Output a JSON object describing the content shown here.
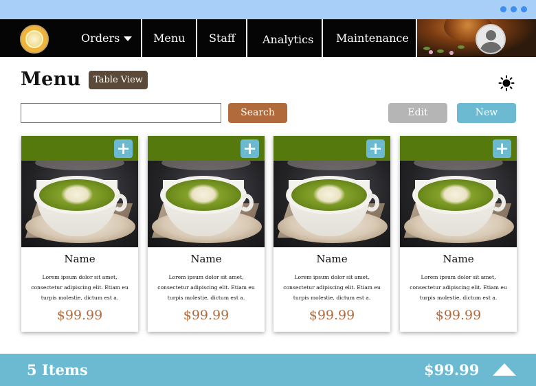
{
  "window": {
    "controls": [
      "dot",
      "dot",
      "dot"
    ]
  },
  "nav": {
    "logo": "lemon-logo-icon",
    "items": [
      {
        "label": "Orders",
        "has_dropdown": true
      },
      {
        "label": "Menu"
      },
      {
        "label": "Staff"
      },
      {
        "label": "Analytics"
      },
      {
        "label": "Maintenance"
      }
    ],
    "avatar": "user-avatar-icon"
  },
  "page": {
    "title": "Menu",
    "view_toggle_label": "Table View",
    "theme_icon": "sun-icon"
  },
  "toolbar": {
    "search_value": "",
    "search_label": "Search",
    "edit_label": "Edit",
    "new_label": "New"
  },
  "cards": [
    {
      "name": "Name",
      "description": "Lorem ipsum dolor sit amet, consectetur adipiscing elit. Etiam eu turpis molestie, dictum est a.",
      "price": "$99.99",
      "add_icon": "plus-icon"
    },
    {
      "name": "Name",
      "description": "Lorem ipsum dolor sit amet, consectetur adipiscing elit. Etiam eu turpis molestie, dictum est a.",
      "price": "$99.99",
      "add_icon": "plus-icon"
    },
    {
      "name": "Name",
      "description": "Lorem ipsum dolor sit amet, consectetur adipiscing elit. Etiam eu turpis molestie, dictum est a.",
      "price": "$99.99",
      "add_icon": "plus-icon"
    },
    {
      "name": "Name",
      "description": "Lorem ipsum dolor sit amet, consectetur adipiscing elit. Etiam eu turpis molestie, dictum est a.",
      "price": "$99.99",
      "add_icon": "plus-icon"
    }
  ],
  "cart": {
    "count_label": "5 Items",
    "total": "$99.99",
    "expand_icon": "triangle-up-icon"
  },
  "colors": {
    "accent_blue": "#6cbad2",
    "search_brown": "#b06a3b",
    "card_band_green": "#55790d",
    "edit_gray": "#b5b5b5",
    "chrome_blue": "#a7cff8"
  }
}
